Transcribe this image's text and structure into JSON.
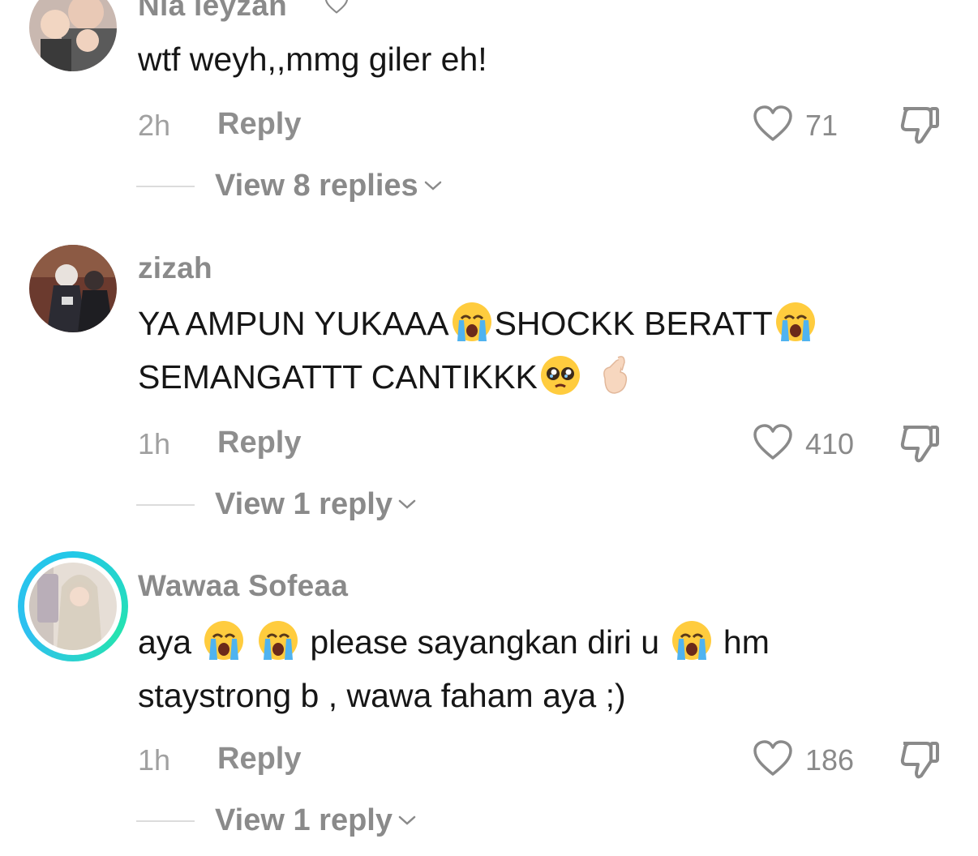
{
  "comments": [
    {
      "username": "Nia leyzan",
      "text_lines": [
        "wtf weyh,,mmg giler eh!"
      ],
      "time": "2h",
      "reply_label": "Reply",
      "likes": "71",
      "view_replies": "View 8 replies"
    },
    {
      "username": "zizah",
      "text_line1_a": "YA AMPUN YUKAAA",
      "text_line1_b": "SHOCKK BERATT",
      "text_line2": "SEMANGATTT CANTIKKK",
      "time": "1h",
      "reply_label": "Reply",
      "likes": "410",
      "view_replies": "View 1 reply"
    },
    {
      "username": "Wawaa Sofeaa",
      "text_line1_a": "aya",
      "text_line1_b": "please sayangkan diri u",
      "text_line1_c": "hm",
      "text_line2": "staystrong b , wawa faham aya ;)",
      "time": "1h",
      "reply_label": "Reply",
      "likes": "186",
      "view_replies": "View 1 reply"
    }
  ],
  "icons": {
    "like": "heart-outline-icon",
    "dislike": "thumbs-down-outline-icon",
    "chevron": "chevron-down-icon",
    "emoji_cry": "loudly-crying-face",
    "emoji_plead": "pleading-face",
    "emoji_hand": "finger-heart-hand"
  },
  "colors": {
    "text": "#161616",
    "muted": "#8a8a8a",
    "story_ring": "#22c8e8"
  }
}
